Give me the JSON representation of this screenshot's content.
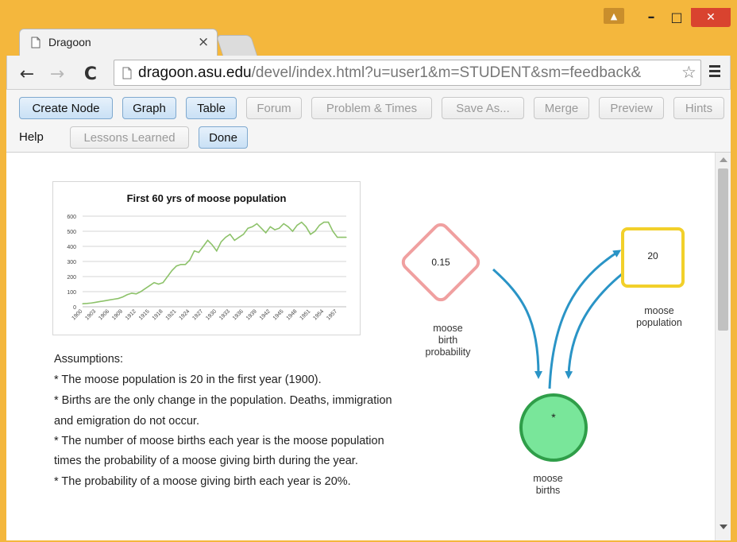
{
  "browser": {
    "tab_title": "Dragoon",
    "tab_close": "×",
    "url_host": "dragoon.asu.edu",
    "url_rest": "/devel/index.html?u=user1&m=STUDENT&sm=feedback&",
    "window_controls": {
      "user": "▲",
      "minimize": "–",
      "maximize": "□",
      "close": "✕"
    }
  },
  "toolbar": {
    "row1": [
      "Create Node",
      "Graph",
      "Table",
      "Forum",
      "Problem & Times",
      "Save As...",
      "Merge",
      "Preview",
      "Hints"
    ],
    "help": "Help",
    "lessons_learned": "Lessons Learned",
    "done": "Done"
  },
  "chart_data": {
    "type": "line",
    "title": "First 60 yrs of moose population",
    "ylim": [
      0,
      600
    ],
    "yticks": [
      0,
      100,
      200,
      300,
      400,
      500,
      600
    ],
    "xticks": [
      "1900",
      "1903",
      "1906",
      "1909",
      "1912",
      "1915",
      "1918",
      "1921",
      "1924",
      "1927",
      "1930",
      "1933",
      "1936",
      "1939",
      "1942",
      "1945",
      "1948",
      "1951",
      "1954",
      "1957"
    ],
    "series": [
      {
        "color": "#8dc26a",
        "x": [
          1900,
          1901,
          1902,
          1903,
          1904,
          1905,
          1906,
          1907,
          1908,
          1909,
          1910,
          1911,
          1912,
          1913,
          1914,
          1915,
          1916,
          1917,
          1918,
          1919,
          1920,
          1921,
          1922,
          1923,
          1924,
          1925,
          1926,
          1927,
          1928,
          1929,
          1930,
          1931,
          1932,
          1933,
          1934,
          1935,
          1936,
          1937,
          1938,
          1939,
          1940,
          1941,
          1942,
          1943,
          1944,
          1945,
          1946,
          1947,
          1948,
          1949,
          1950,
          1951,
          1952,
          1953,
          1954,
          1955,
          1956,
          1957,
          1958,
          1959
        ],
        "values": [
          20,
          22,
          25,
          30,
          35,
          40,
          45,
          50,
          55,
          65,
          80,
          90,
          85,
          100,
          120,
          140,
          160,
          150,
          160,
          200,
          240,
          270,
          280,
          280,
          310,
          370,
          360,
          400,
          440,
          410,
          370,
          430,
          460,
          480,
          440,
          460,
          480,
          520,
          530,
          550,
          520,
          490,
          530,
          510,
          520,
          550,
          530,
          500,
          540,
          560,
          530,
          480,
          500,
          540,
          560,
          560,
          500,
          460,
          460,
          460
        ]
      }
    ]
  },
  "assumptions": [
    "Assumptions:",
    " * The moose population is 20 in the first year (1900).",
    " * Births are the only change in the population. Deaths, immigration",
    "and emigration do not occur.",
    " * The number of moose births each year is the moose population",
    "times the probability of a moose giving birth during the year.",
    " * The probability of a moose giving birth each year is 20%."
  ],
  "nodes": {
    "probability": {
      "value": "0.15",
      "label": [
        "moose",
        "birth",
        "probability"
      ],
      "border": "#f0a0a0"
    },
    "population": {
      "value": "20",
      "label": [
        "moose",
        "population"
      ],
      "border": "#f2d02a"
    },
    "births": {
      "value": "*",
      "label": [
        "moose",
        "births"
      ],
      "fill": "#79e69a",
      "border": "#2f9e49"
    }
  },
  "colors": {
    "arrow": "#2a94c6",
    "frame": "#f4b73d",
    "close_btn": "#d9432f"
  }
}
